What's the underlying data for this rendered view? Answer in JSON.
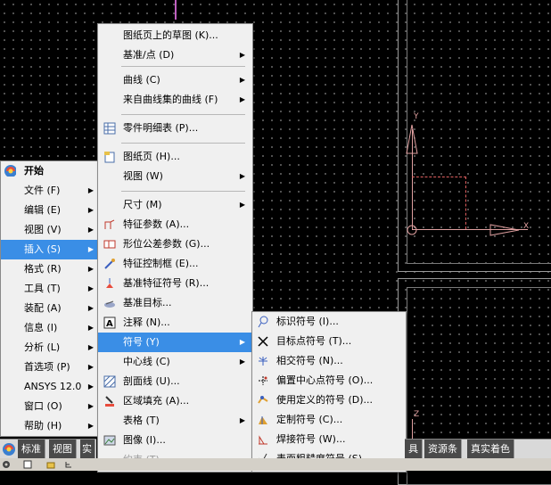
{
  "start_menu": {
    "title": "开始",
    "items": [
      {
        "label": "文件 (F)",
        "arrow": true
      },
      {
        "label": "编辑 (E)",
        "arrow": true
      },
      {
        "label": "视图 (V)",
        "arrow": true
      },
      {
        "label": "插入 (S)",
        "arrow": true,
        "highlighted": true
      },
      {
        "label": "格式 (R)",
        "arrow": true
      },
      {
        "label": "工具 (T)",
        "arrow": true
      },
      {
        "label": "装配 (A)",
        "arrow": true
      },
      {
        "label": "信息 (I)",
        "arrow": true
      },
      {
        "label": "分析 (L)",
        "arrow": true
      },
      {
        "label": "首选项 (P)",
        "arrow": true
      },
      {
        "label": "ANSYS 12.0",
        "arrow": true
      },
      {
        "label": "窗口 (O)",
        "arrow": true
      },
      {
        "label": "帮助 (H)",
        "arrow": true
      }
    ]
  },
  "insert_menu": {
    "items": [
      {
        "label": "图纸页上的草图 (K)...",
        "arrow": false,
        "icon": "none"
      },
      {
        "label": "基准/点 (D)",
        "arrow": true,
        "icon": "none"
      },
      {
        "label": "曲线 (C)",
        "arrow": true,
        "icon": "none"
      },
      {
        "label": "来自曲线集的曲线 (F)",
        "arrow": true,
        "icon": "none"
      },
      {
        "label": "零件明细表 (P)...",
        "arrow": false,
        "icon": "parts-list-icon"
      },
      {
        "label": "图纸页 (H)...",
        "arrow": false,
        "icon": "sheet-icon"
      },
      {
        "label": "视图 (W)",
        "arrow": true,
        "icon": "none"
      },
      {
        "label": "尺寸 (M)",
        "arrow": true,
        "icon": "none"
      },
      {
        "label": "特征参数 (A)...",
        "arrow": false,
        "icon": "feature-parameter-icon"
      },
      {
        "label": "形位公差参数 (G)...",
        "arrow": false,
        "icon": "gdt-parameter-icon"
      },
      {
        "label": "特征控制框 (E)...",
        "arrow": false,
        "icon": "feature-control-frame-icon"
      },
      {
        "label": "基准特征符号 (R)...",
        "arrow": false,
        "icon": "datum-feature-symbol-icon"
      },
      {
        "label": "基准目标...",
        "arrow": false,
        "icon": "datum-target-icon"
      },
      {
        "label": "注释 (N)...",
        "arrow": false,
        "icon": "note-icon"
      },
      {
        "label": "符号 (Y)",
        "arrow": true,
        "icon": "none",
        "highlighted": true
      },
      {
        "label": "中心线 (C)",
        "arrow": true,
        "icon": "none"
      },
      {
        "label": "剖面线 (U)...",
        "arrow": false,
        "icon": "crosshatch-icon"
      },
      {
        "label": "区域填充 (A)...",
        "arrow": false,
        "icon": "area-fill-icon"
      },
      {
        "label": "表格 (T)",
        "arrow": true,
        "icon": "none"
      },
      {
        "label": "图像 (I)...",
        "arrow": false,
        "icon": "image-icon"
      },
      {
        "label": "约束 (T)...",
        "arrow": false,
        "icon": "constraint-icon",
        "disabled": true
      }
    ]
  },
  "symbol_menu": {
    "items": [
      {
        "label": "标识符号 (I)...",
        "icon": "id-symbol-icon"
      },
      {
        "label": "目标点符号 (T)...",
        "icon": "target-point-icon"
      },
      {
        "label": "相交符号 (N)...",
        "icon": "intersection-symbol-icon"
      },
      {
        "label": "偏置中心点符号 (O)...",
        "icon": "offset-center-point-icon"
      },
      {
        "label": "使用定义的符号 (D)...",
        "icon": "user-defined-symbol-icon"
      },
      {
        "label": "定制符号 (C)...",
        "icon": "custom-symbol-icon"
      },
      {
        "label": "焊接符号 (W)...",
        "icon": "weld-symbol-icon"
      },
      {
        "label": "表面粗糙度符号 (S)...",
        "icon": "surface-finish-icon"
      }
    ]
  },
  "tabs_left": [
    "标准",
    "视图",
    "实"
  ],
  "tabs_right": [
    "具",
    "资源条",
    "真实着色"
  ],
  "axis_labels": {
    "y": "Y",
    "x": "X",
    "z": "Z"
  },
  "colors": {
    "highlight": "#3a8ee6",
    "menu_bg": "#f0f0f0",
    "axis": "#e0a0a0"
  }
}
